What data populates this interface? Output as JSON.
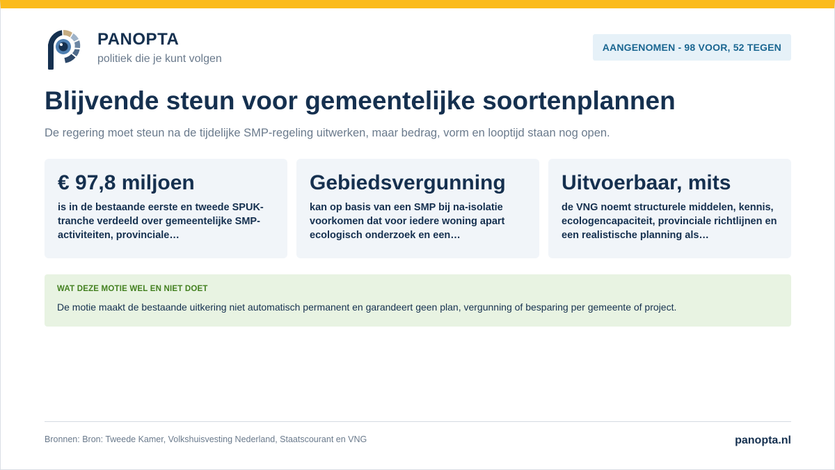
{
  "brand": {
    "name": "PANOPTA",
    "tagline": "politiek die je kunt volgen",
    "logo_icon": "eye-p-logo-icon"
  },
  "status": {
    "label": "AANGENOMEN - 98 VOOR, 52 TEGEN"
  },
  "headline": {
    "title": "Blijvende steun voor gemeentelijke soortenplannen",
    "subtitle": "De regering moet steun na de tijdelijke SMP-regeling uitwerken, maar bedrag, vorm en looptijd staan nog open."
  },
  "cards": [
    {
      "heading": "€ 97,8 miljoen",
      "body": "is in de bestaande eerste en tweede SPUK-tranche verdeeld over gemeentelijke SMP-activiteiten, provinciale…"
    },
    {
      "heading": "Gebiedsvergunning",
      "body": "kan op basis van een SMP bij na-isolatie voorkomen dat voor iedere woning apart ecologisch onderzoek en een…"
    },
    {
      "heading": "Uitvoerbaar, mits",
      "body": "de VNG noemt structurele middelen, kennis, ecologencapaciteit, provinciale richtlijnen en een realistische planning als…"
    }
  ],
  "note": {
    "label": "WAT DEZE MOTIE WEL EN NIET DOET",
    "text": "De motie maakt de bestaande uitkering niet automatisch permanent en garandeert geen plan, vergunning of besparing per gemeente of project."
  },
  "footer": {
    "sources": "Bronnen: Bron: Tweede Kamer, Volkshuisvesting Nederland, Staatscourant en VNG",
    "site": "panopta.nl"
  },
  "colors": {
    "accent_bar": "#fbbb1c",
    "navy": "#15304f",
    "badge_bg": "#e6f1f8",
    "badge_text": "#1a6691",
    "card_bg": "#f1f5f9",
    "note_bg": "#e8f3e2",
    "note_label": "#438020"
  }
}
